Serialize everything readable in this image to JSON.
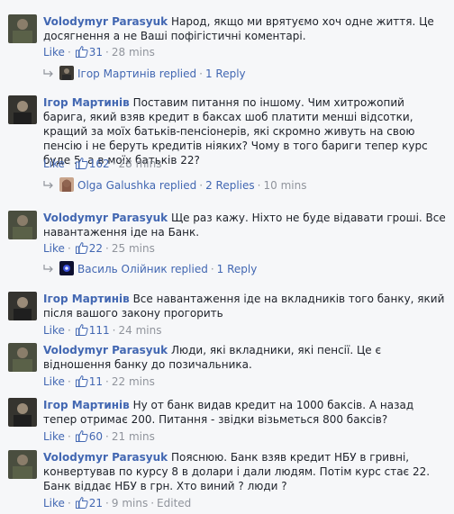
{
  "ui": {
    "like": "Like",
    "dot": "·"
  },
  "comments": [
    {
      "author": "Volodymyr Parasyuk",
      "text": "Народ, якщо ми врятуємо хоч одне життя. Це досягнення а не Ваші пофігістичні коментарі.",
      "likes": "31",
      "time": "28 mins",
      "reply": {
        "name": "Ігор Мартинів replied",
        "count": "1 Reply",
        "time": ""
      }
    },
    {
      "author": "Ігор Мартинів",
      "text": "Поставим питання по іншому. Чим хитрожопий барига, який взяв кредит в баксах шоб платити менші відсотки, кращий за моїх батьків-пенсіонерів, які скромно живуть на свою пенсію і не беруть кредитів ніяких? Чому в того бариги тепер курс буде 5, а в моїх батьків 22?",
      "likes": "162",
      "time": "28 mins",
      "reply": {
        "name": "Olga Galushka replied",
        "count": "2 Replies",
        "time": "10 mins"
      }
    },
    {
      "author": "Volodymyr Parasyuk",
      "text": "Ще раз кажу. Ніхто не буде відавати гроші. Все навантаження іде на Банк.",
      "likes": "22",
      "time": "25 mins",
      "reply": {
        "name": "Василь Олійник replied",
        "count": "1 Reply",
        "time": ""
      }
    },
    {
      "author": "Ігор Мартинів",
      "text": "Все навантаження іде на вкладників того банку, який після вашого закону прогорить",
      "likes": "111",
      "time": "24 mins"
    },
    {
      "author": "Volodymyr Parasyuk",
      "text": "Люди, які вкладники, які пенсії. Це є відношення банку до позичальника.",
      "likes": "11",
      "time": "22 mins"
    },
    {
      "author": "Ігор Мартинів",
      "text": "Ну от банк видав кредит на 1000 баксів. А назад тепер отримає 200. Питання - звідки візьметься 800 баксів?",
      "likes": "60",
      "time": "21 mins"
    },
    {
      "author": "Volodymyr Parasyuk",
      "text": "Пояснюю. Банк взяв кредит НБУ в гривні, конвертував по курсу 8 в долари і дали людям. Потім курс стає 22. Банк віддає НБУ в грн. Хто виний ? люди ?",
      "likes": "21",
      "time": "9 mins",
      "edited": "Edited"
    }
  ]
}
